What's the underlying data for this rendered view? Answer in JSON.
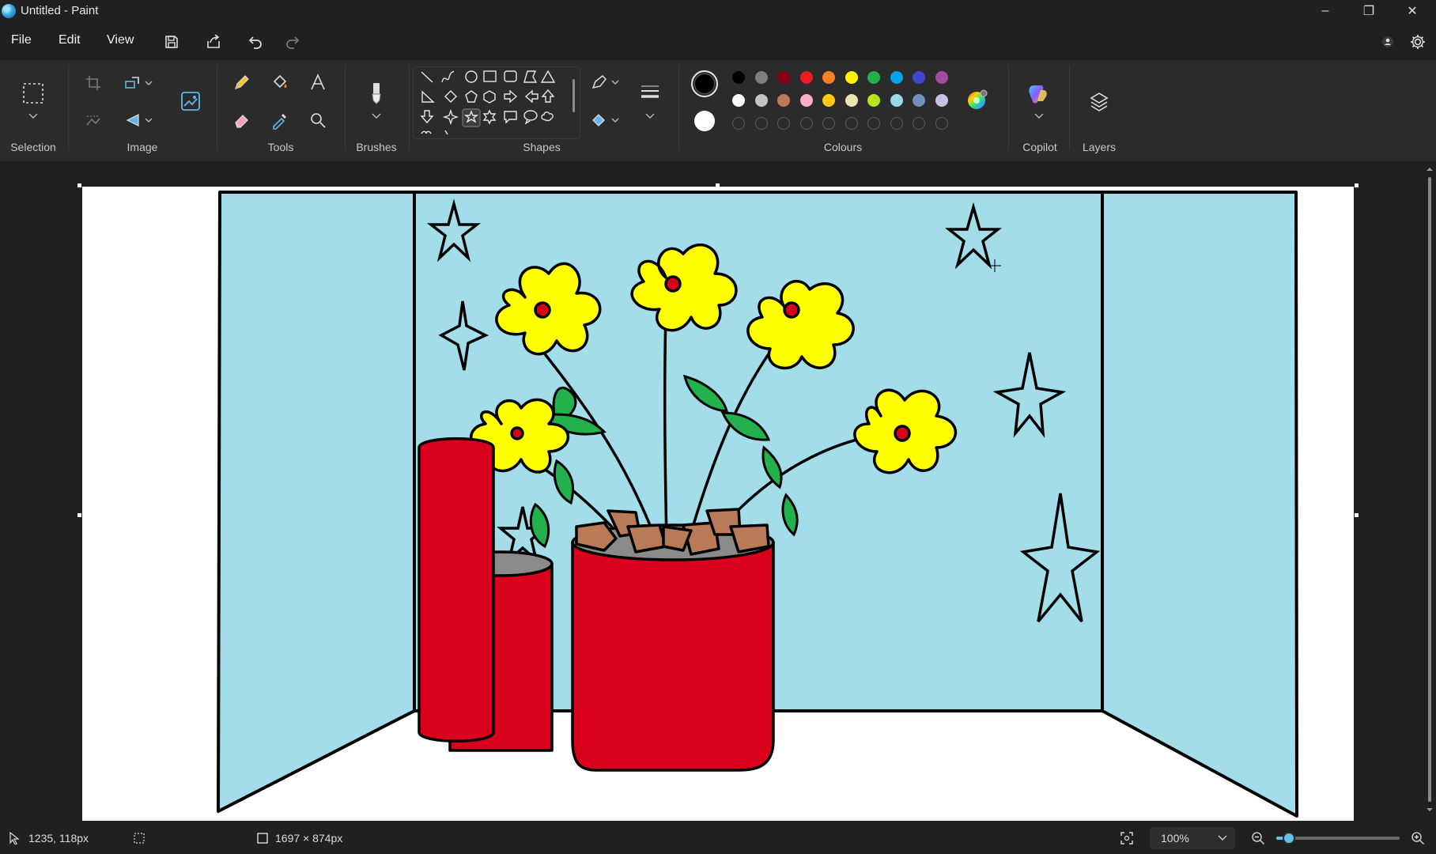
{
  "window": {
    "title": "Untitled - Paint",
    "controls": {
      "minimize": "–",
      "restore": "❐",
      "close": "✕"
    }
  },
  "menu": {
    "file": "File",
    "edit": "Edit",
    "view": "View"
  },
  "ribbon": {
    "groups": {
      "selection": "Selection",
      "image": "Image",
      "tools": "Tools",
      "brushes": "Brushes",
      "shapes": "Shapes",
      "colours": "Colours",
      "copilot": "Copilot",
      "layers": "Layers"
    },
    "selected_shape": "star-5",
    "primary_color": "#000000",
    "secondary_color": "#ffffff",
    "palette_row1": [
      "#000000",
      "#7f7f7f",
      "#880015",
      "#ed1c24",
      "#ff7f27",
      "#fff200",
      "#22b14c",
      "#00a2e8",
      "#3f48cc",
      "#a349a4"
    ],
    "palette_row2": [
      "#ffffff",
      "#c3c3c3",
      "#b97a57",
      "#ffaec9",
      "#ffc90e",
      "#efe4b0",
      "#b5e61d",
      "#99d9ea",
      "#7092be",
      "#c8bfe7"
    ]
  },
  "status": {
    "cursor_position": "1235, 118px",
    "canvas_size": "1697 × 874px",
    "zoom": "100%",
    "zoom_fraction": 0.1
  },
  "drawing": {
    "wall_color": "#a3dde9",
    "flower_color": "#ffff00",
    "leaf_color": "#22b14c",
    "pot_color": "#d9001b",
    "soil_color": "#b97a57",
    "outline_color": "#000000"
  }
}
